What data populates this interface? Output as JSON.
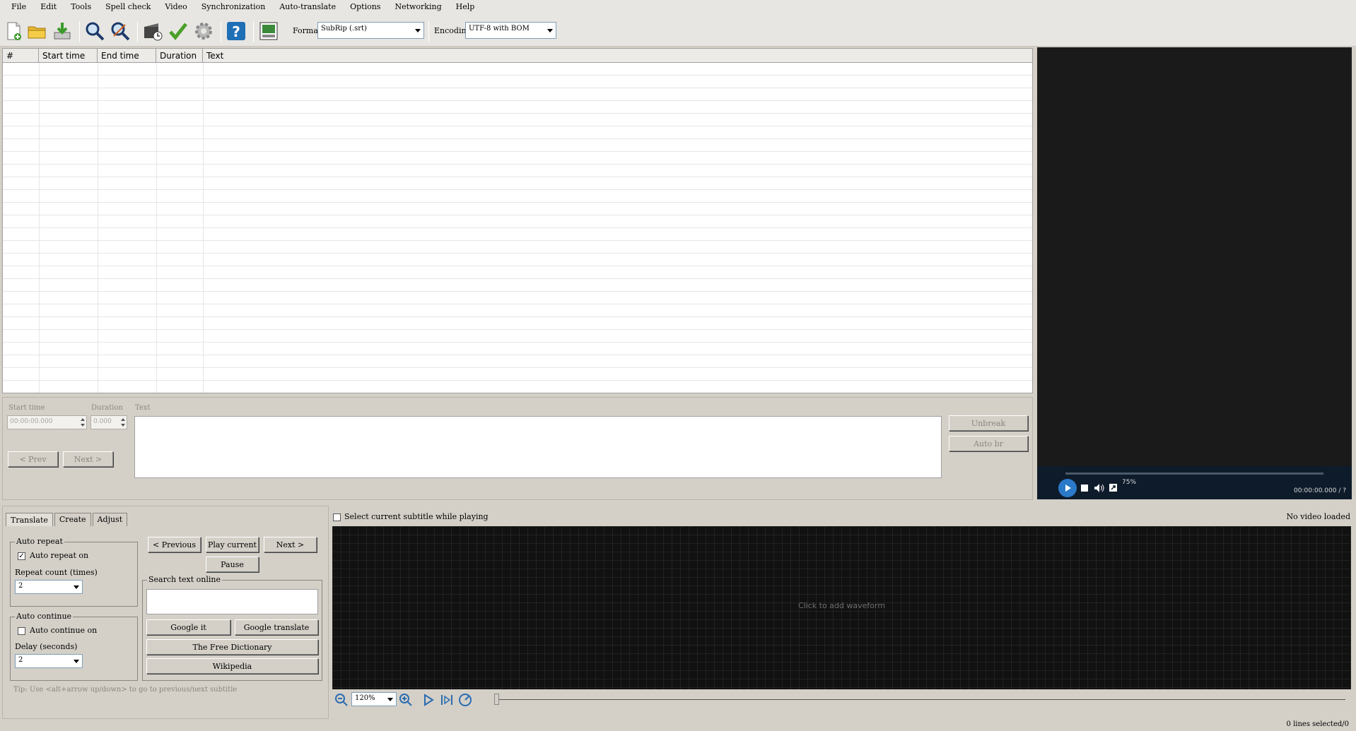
{
  "menu": [
    "File",
    "Edit",
    "Tools",
    "Spell check",
    "Video",
    "Synchronization",
    "Auto-translate",
    "Options",
    "Networking",
    "Help"
  ],
  "toolbar": {
    "format_label": "Format",
    "format_value": "SubRip (.srt)",
    "encoding_label": "Encoding",
    "encoding_value": "UTF-8 with BOM"
  },
  "grid": {
    "columns": [
      "#",
      "Start time",
      "End time",
      "Duration",
      "Text"
    ]
  },
  "video": {
    "volume": "75%",
    "time": "00:00:00.000 / ?"
  },
  "edit": {
    "start_time_label": "Start time",
    "start_time_value": "00:00:00.000",
    "duration_label": "Duration",
    "duration_value": "0.000",
    "text_label": "Text",
    "prev_button": "< Prev",
    "next_button": "Next >",
    "unbreak_button": "Unbreak",
    "auto_br_button": "Auto br"
  },
  "tabs": [
    "Translate",
    "Create",
    "Adjust"
  ],
  "translate": {
    "auto_repeat_group": "Auto repeat",
    "auto_repeat_on": "Auto repeat on",
    "repeat_count_label": "Repeat count (times)",
    "repeat_count_value": "2",
    "auto_continue_group": "Auto continue",
    "auto_continue_on": "Auto continue on",
    "delay_label": "Delay (seconds)",
    "delay_value": "2",
    "previous_button": "< Previous",
    "play_current_button": "Play current",
    "next_button": "Next >",
    "pause_button": "Pause",
    "search_group": "Search text online",
    "google_it": "Google it",
    "google_translate": "Google translate",
    "free_dictionary": "The Free Dictionary",
    "wikipedia": "Wikipedia",
    "tip": "Tip: Use <alt+arrow up/down> to go to previous/next subtitle"
  },
  "waveform": {
    "select_current": "Select current subtitle while playing",
    "no_video": "No video loaded",
    "click_to_add": "Click to add waveform",
    "zoom": "120%"
  },
  "status": {
    "lines_selected": "0 lines selected/0"
  }
}
